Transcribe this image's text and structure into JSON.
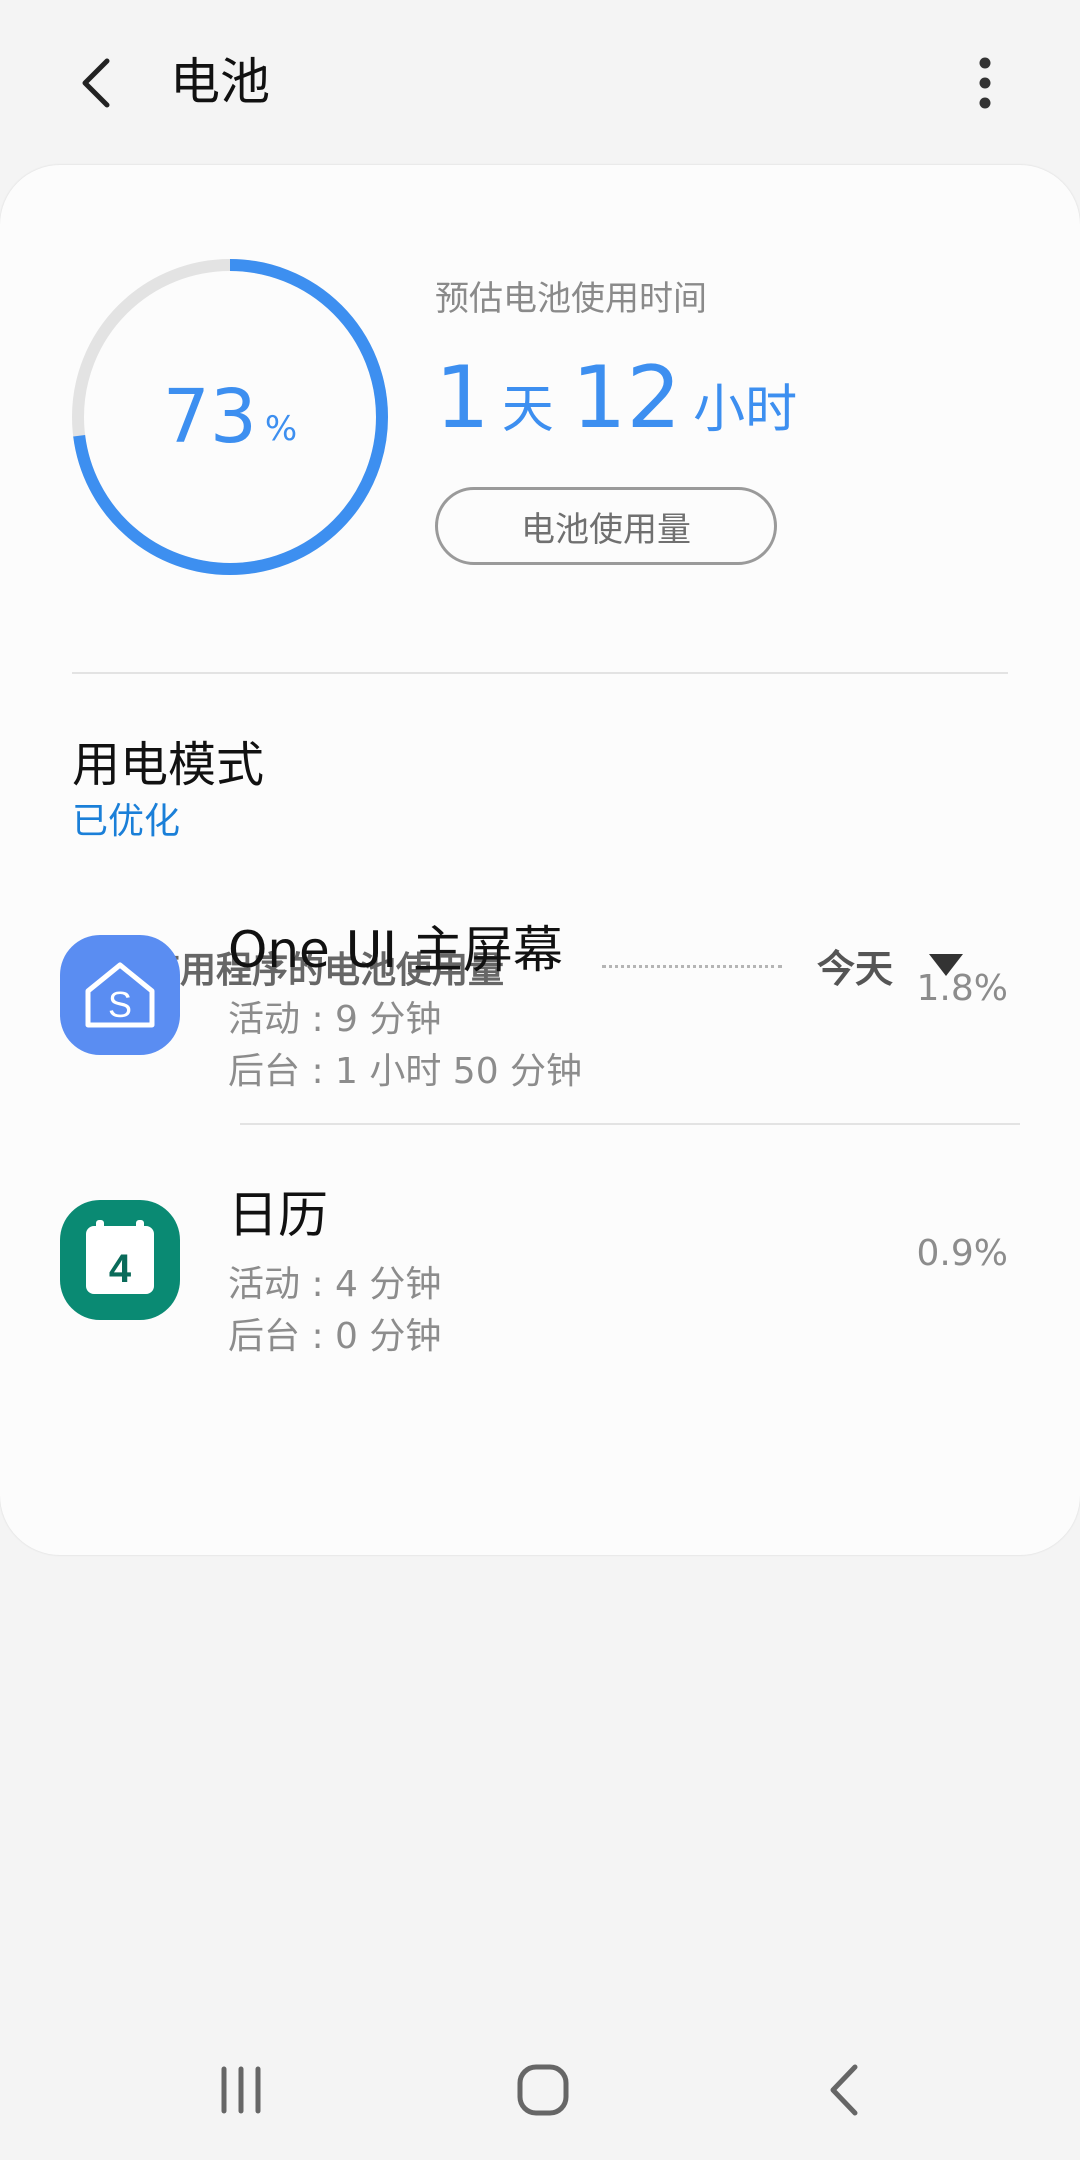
{
  "header": {
    "title": "电池",
    "back_icon": "back-arrow-icon",
    "more_icon": "more-vert-icon"
  },
  "battery": {
    "percent": "73",
    "percent_unit": "%",
    "level_fraction": 0.73,
    "estimate_label": "预估电池使用时间",
    "estimate_days": "1",
    "estimate_days_unit": "天",
    "estimate_hours": "12",
    "estimate_hours_unit": "小时",
    "usage_button_label": "电池使用量",
    "ring_color": "#3d8ff0",
    "ring_track_color": "#e3e3e3"
  },
  "power_mode": {
    "title": "用电模式",
    "value": "已优化"
  },
  "per_app": {
    "title": "每个应用程序的电池使用量",
    "period": "今天"
  },
  "apps": [
    {
      "name": "One UI 主屏幕",
      "active": "活动 : 9 分钟",
      "background": "后台 : 1 小时 50 分钟",
      "percent": "1.8%",
      "icon": "home-s-icon",
      "icon_color": "#5a8df2"
    },
    {
      "name": "日历",
      "active": "活动 : 4 分钟",
      "background": "后台 : 0 分钟",
      "percent": "0.9%",
      "icon": "calendar-icon",
      "icon_color": "#0a8a73",
      "icon_text": "4"
    }
  ],
  "nav": {
    "recents_icon": "recents-icon",
    "home_icon": "home-icon",
    "back_icon": "nav-back-icon"
  }
}
